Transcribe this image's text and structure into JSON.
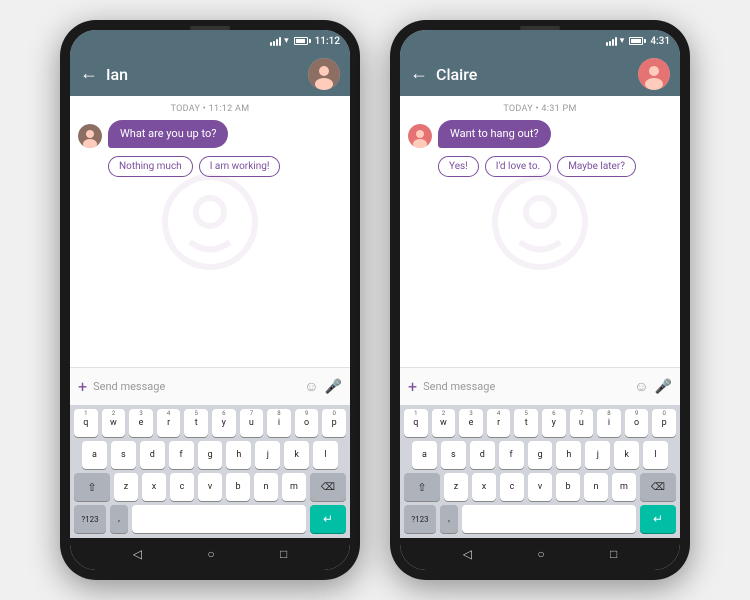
{
  "phone1": {
    "status": {
      "time": "11:12"
    },
    "header": {
      "contact": "Ian",
      "back_label": "←"
    },
    "chat": {
      "date_divider": "TODAY • 11:12 AM",
      "message": "What are you up to?",
      "smart_replies": [
        "Nothing much",
        "I am working!"
      ]
    },
    "input": {
      "placeholder": "Send message"
    },
    "keyboard": {
      "row1": [
        "q",
        "w",
        "e",
        "r",
        "t",
        "y",
        "u",
        "i",
        "o",
        "p"
      ],
      "row1_nums": [
        "1",
        "2",
        "3",
        "4",
        "5",
        "6",
        "7",
        "8",
        "9",
        "0"
      ],
      "row2": [
        "a",
        "s",
        "d",
        "f",
        "g",
        "h",
        "j",
        "k",
        "l"
      ],
      "row3": [
        "z",
        "x",
        "c",
        "v",
        "b",
        "n",
        "m"
      ],
      "bottom_left": "?123",
      "bottom_comma": ",",
      "bottom_enter_icon": "↵"
    }
  },
  "phone2": {
    "status": {
      "time": "4:31"
    },
    "header": {
      "contact": "Claire",
      "back_label": "←"
    },
    "chat": {
      "date_divider": "TODAY • 4:31 PM",
      "message": "Want to hang out?",
      "smart_replies": [
        "Yes!",
        "I'd love to.",
        "Maybe later?"
      ]
    },
    "input": {
      "placeholder": "Send message"
    },
    "keyboard": {
      "row1": [
        "q",
        "w",
        "e",
        "r",
        "t",
        "y",
        "u",
        "i",
        "o",
        "p"
      ],
      "row1_nums": [
        "1",
        "2",
        "3",
        "4",
        "5",
        "6",
        "7",
        "8",
        "9",
        "0"
      ],
      "row2": [
        "a",
        "s",
        "d",
        "f",
        "g",
        "h",
        "j",
        "k",
        "l"
      ],
      "row3": [
        "z",
        "x",
        "c",
        "v",
        "b",
        "n",
        "m"
      ],
      "bottom_left": "?123",
      "bottom_comma": ",",
      "bottom_enter_icon": "↵"
    }
  },
  "colors": {
    "appbar": "#546e7a",
    "bubble": "#7b4f9e",
    "chip_border": "#7b4f9e",
    "enter_key": "#00bfa5"
  }
}
